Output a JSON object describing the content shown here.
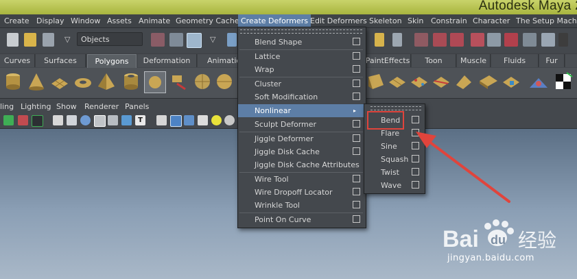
{
  "window": {
    "title": "Autodesk Maya 2"
  },
  "menubar": {
    "items": [
      "Create",
      "Display",
      "Window",
      "Assets",
      "Animate",
      "Geometry Cache",
      "Create Deformers",
      "Edit Deformers",
      "Skeleton",
      "Skin",
      "Constrain",
      "Character",
      "The Setup Machine"
    ]
  },
  "statusline": {
    "object_mode": "Objects"
  },
  "shelf_tabs": [
    "Curves",
    "Surfaces",
    "Polygons",
    "Deformation",
    "Animation",
    "PaintEffects",
    "Toon",
    "Muscle",
    "Fluids",
    "Fur"
  ],
  "panel_menu": [
    "ling",
    "Lighting",
    "Show",
    "Renderer",
    "Panels"
  ],
  "dropdown": {
    "items": [
      {
        "label": "Blend Shape",
        "option": true
      },
      {
        "label": "Lattice",
        "option": true
      },
      {
        "label": "Wrap",
        "option": true
      },
      {
        "label": "Cluster",
        "option": true
      },
      {
        "label": "Soft Modification",
        "option": true
      },
      {
        "label": "Nonlinear",
        "submenu": true
      },
      {
        "label": "Sculpt Deformer",
        "option": true
      },
      {
        "label": "Jiggle Deformer",
        "option": true
      },
      {
        "label": "Jiggle Disk Cache",
        "option": true
      },
      {
        "label": "Jiggle Disk Cache Attributes",
        "option": false
      },
      {
        "label": "Wire Tool",
        "option": true
      },
      {
        "label": "Wire Dropoff Locator",
        "option": true
      },
      {
        "label": "Wrinkle Tool",
        "option": true
      },
      {
        "label": "Point On Curve",
        "option": true
      }
    ]
  },
  "submenu": {
    "items": [
      "Bend",
      "Flare",
      "Sine",
      "Squash",
      "Twist",
      "Wave"
    ]
  },
  "watermark": {
    "brand_left": "Bai",
    "brand_right": "du",
    "brand_cn": "经验",
    "url": "jingyan.baidu.com"
  },
  "colors": {
    "highlight": "#5d7ea6",
    "callout": "#e0443c",
    "title_strip": "#b9c452"
  }
}
